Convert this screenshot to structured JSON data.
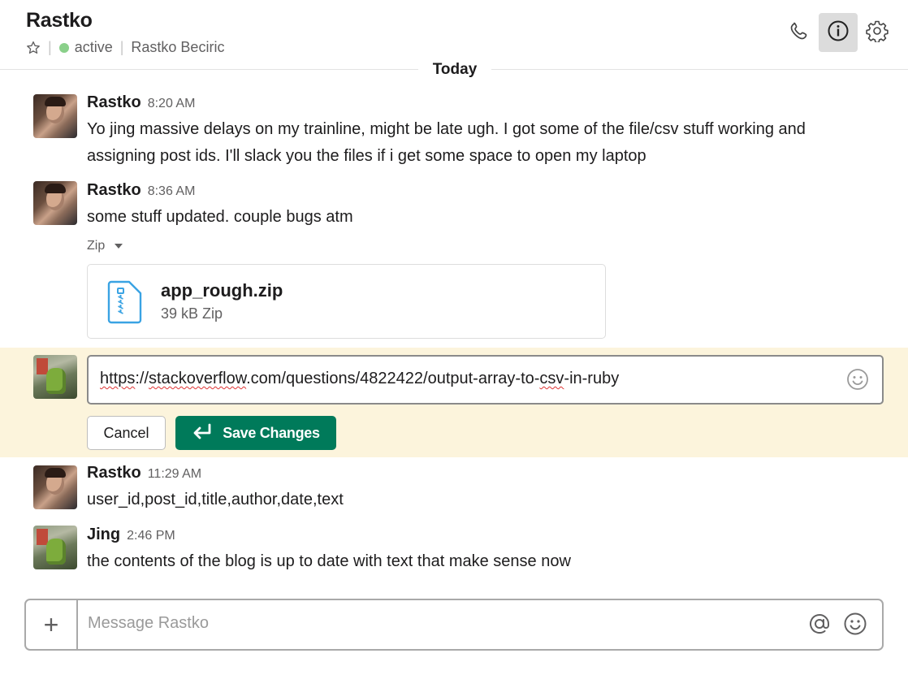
{
  "header": {
    "channel_name": "Rastko",
    "status": "active",
    "full_name": "Rastko Beciric",
    "icons": [
      "star-icon",
      "phone-icon",
      "info-icon",
      "gear-icon"
    ]
  },
  "day_divider": "Today",
  "messages": [
    {
      "sender": "Rastko",
      "time": "8:20 AM",
      "text": "Yo jing massive delays on my trainline, might be late ugh. I got some of the file/csv stuff working and assigning post ids. I'll slack you the files if i get some space to open my laptop"
    },
    {
      "sender": "Rastko",
      "time": "8:36 AM",
      "text": "some stuff updated. couple bugs atm",
      "attachment": {
        "label": "Zip",
        "file_name": "app_rough.zip",
        "file_meta": "39 kB Zip"
      }
    },
    {
      "sender": "Rastko",
      "time": "11:29 AM",
      "text": "user_id,post_id,title,author,date,text"
    },
    {
      "sender": "Jing",
      "time": "2:46 PM",
      "text": "the contents of the blog is up to date with text that make sense now"
    }
  ],
  "edit": {
    "text_parts": [
      "https",
      "://",
      "stackoverflow",
      ".com/questions/4822422/output-array-to-",
      "csv",
      "-in-ruby"
    ],
    "cancel_label": "Cancel",
    "save_label": "Save Changes"
  },
  "composer": {
    "placeholder": "Message Rastko",
    "plus_label": "+"
  },
  "colors": {
    "accent": "#007a5a",
    "edit_highlight": "#fcf4dc",
    "presence": "#8ad08a",
    "file_icon": "#3aa3e3"
  }
}
